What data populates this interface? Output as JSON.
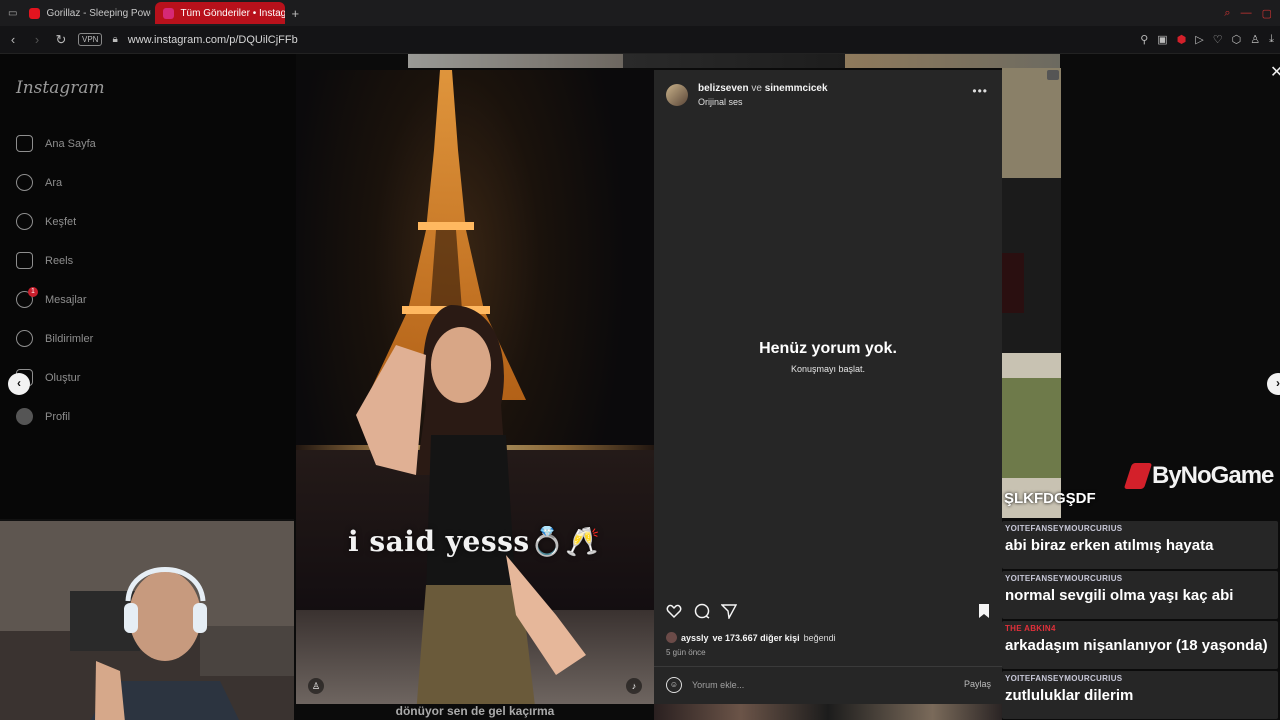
{
  "browser": {
    "tabs": [
      {
        "label": "Gorillaz - Sleeping Powde",
        "favicon_color": "#e3141f"
      },
      {
        "label": "Tüm Gönderiler • Instagr",
        "favicon_color": "#d62976"
      }
    ],
    "new_tab": "+",
    "url": "www.instagram.com/p/DQUilCjFFb",
    "vpn": "VPN"
  },
  "sidebar": {
    "logo": "Instagram",
    "items": [
      {
        "label": "Ana Sayfa",
        "icon": "home-icon"
      },
      {
        "label": "Ara",
        "icon": "search-icon"
      },
      {
        "label": "Keşfet",
        "icon": "compass-icon"
      },
      {
        "label": "Reels",
        "icon": "reels-icon"
      },
      {
        "label": "Mesajlar",
        "icon": "messenger-icon",
        "badge": "1"
      },
      {
        "label": "Bildirimler",
        "icon": "heart-icon"
      },
      {
        "label": "Oluştur",
        "icon": "plus-icon"
      },
      {
        "label": "Profil",
        "icon": "avatar-icon"
      }
    ]
  },
  "post": {
    "author1": "belizseven",
    "joiner": "ve",
    "author2": "sinemmcicek",
    "audio": "Orijinal ses",
    "caption_overlay": "i said yesss💍🥂",
    "empty_title": "Henüz yorum yok.",
    "empty_sub": "Konuşmayı başlat.",
    "likes_user": "ayssly",
    "likes_rest": "ve 173.667 diğer kişi",
    "likes_suffix": "beğendi",
    "time": "5 gün önce",
    "comment_placeholder": "Yorum ekle...",
    "share_label": "Paylaş"
  },
  "overlay": {
    "brand": "ByNoGame",
    "first_line": "ŞLKFDGŞDF",
    "subtitle": "dönüyor sen de gel kaçırma",
    "messages": [
      {
        "user": "YOITEFANSEYMOURCURIUS",
        "user_color": "#c8c8d8",
        "text": "abi biraz erken atılmış hayata"
      },
      {
        "user": "YOITEFANSEYMOURCURIUS",
        "user_color": "#c8c8d8",
        "text": "normal sevgili olma yaşı kaç abi"
      },
      {
        "user": "THE ABKIN4",
        "user_color": "#e0303a",
        "text": "arkadaşım nişanlanıyor (18 yaşonda)"
      },
      {
        "user": "YOITEFANSEYMOURCURIUS",
        "user_color": "#c8c8d8",
        "text": "zutluluklar dilerim"
      }
    ]
  }
}
